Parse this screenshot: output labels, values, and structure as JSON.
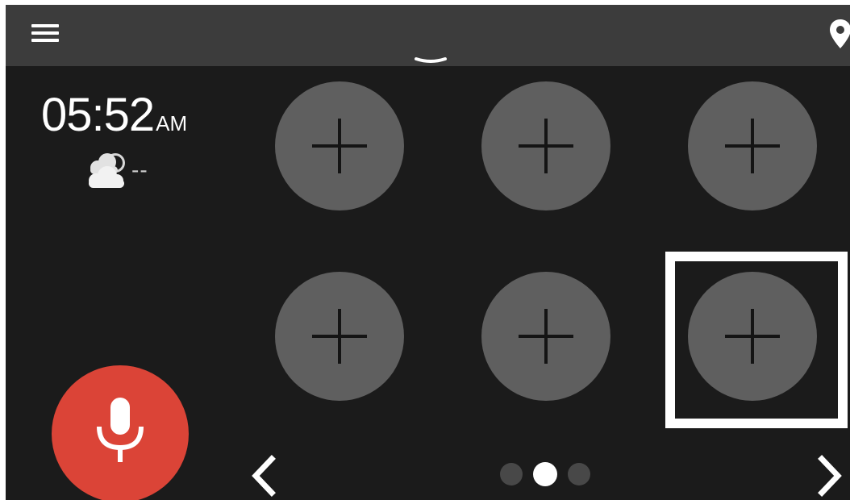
{
  "topbar": {
    "menu_icon": "hamburger-menu-icon",
    "location_icon": "location-pin-icon",
    "expand_icon": "chevron-down-handle-icon"
  },
  "status": {
    "time": "05:52",
    "period": "AM",
    "weather_icon": "partly-cloudy-icon",
    "temperature": "--"
  },
  "shortcuts": {
    "slots": [
      {
        "state": "empty",
        "icon": "plus-icon"
      },
      {
        "state": "empty",
        "icon": "plus-icon"
      },
      {
        "state": "empty",
        "icon": "plus-icon"
      },
      {
        "state": "empty",
        "icon": "plus-icon"
      },
      {
        "state": "empty",
        "icon": "plus-icon"
      },
      {
        "state": "empty",
        "icon": "plus-icon",
        "focused": true
      }
    ]
  },
  "voice": {
    "icon": "microphone-icon",
    "color": "#db4437"
  },
  "pager": {
    "pages": 3,
    "current_page": 2,
    "prev_icon": "chevron-left-icon",
    "next_icon": "chevron-right-icon"
  },
  "colors": {
    "background": "#1b1b1b",
    "topbar": "#3c3c3c",
    "tile": "#5f5f5f",
    "accent_red": "#db4437",
    "focus_border": "#ffffff"
  }
}
